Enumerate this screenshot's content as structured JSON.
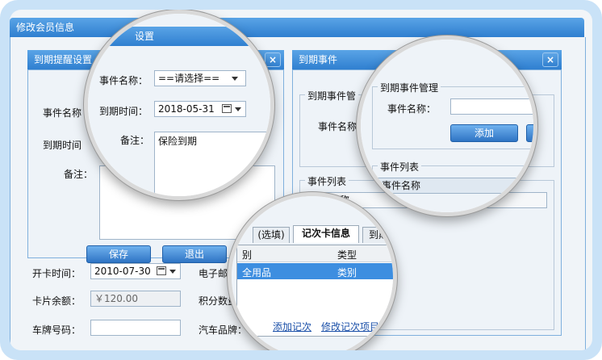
{
  "main_window": {
    "title": "修改会员信息"
  },
  "remind_dialog": {
    "title": "到期提醒设置",
    "title_partial": "设置",
    "event_name_label": "事件名称：",
    "event_name_value": "==请选择==",
    "expire_time_label": "到期时间：",
    "expire_time_value": "2018-05-31",
    "note_label": "备注：",
    "note_value": "保险到期",
    "save_label": "保存",
    "exit_label": "退出",
    "bg_event_label": "事件名称",
    "bg_time_label": "到期时间",
    "bg_note_label": "备注："
  },
  "member_form": {
    "open_date_label": "开卡时间：",
    "open_date_value": "2010-07-30",
    "email_label": "电子邮",
    "balance_label": "卡片余额：",
    "balance_value": "￥120.00",
    "points_label": "积分数量",
    "plate_label": "车牌号码：",
    "brand_label": "汽车品牌："
  },
  "event_dialog": {
    "title": "到期事件",
    "manage_group": "到期事件管理",
    "manage_group_partial": "到期事件管",
    "name_label": "事件名称：",
    "name_label_partial": "事件名称",
    "add_label": "添加",
    "list_group": "事件列表",
    "list_header": "事件名称"
  },
  "card_tabs": {
    "tabs": [
      "(选填)",
      "记次卡信息",
      "到期"
    ],
    "col_category": "别",
    "col_type": "类型",
    "row_name": "全用品",
    "row_type": "类别",
    "add_link": "添加记次",
    "edit_link": "修改记次项目"
  },
  "colors": {
    "title_bar": "#2f7fd0",
    "selection": "#3d8ee0",
    "frame": "#c9e2f7"
  }
}
